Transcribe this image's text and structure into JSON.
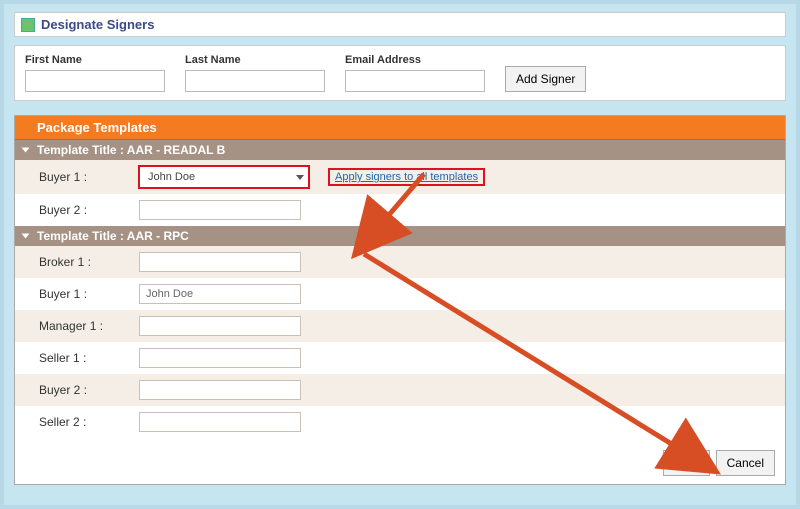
{
  "window": {
    "title": "Designate Signers"
  },
  "form": {
    "first_name": {
      "label": "First Name",
      "value": ""
    },
    "last_name": {
      "label": "Last Name",
      "value": ""
    },
    "email": {
      "label": "Email Address",
      "value": ""
    },
    "add_signer": "Add Signer"
  },
  "panel": {
    "header": "Package Templates",
    "templates": [
      {
        "title": "Template Title : AAR - READAL B",
        "rows": [
          {
            "label": "Buyer 1 :",
            "value": "John Doe",
            "dropdown": true
          },
          {
            "label": "Buyer 2 :",
            "value": ""
          }
        ],
        "apply_link": "Apply signers to all templates"
      },
      {
        "title": "Template Title : AAR - RPC",
        "rows": [
          {
            "label": "Broker 1 :",
            "value": ""
          },
          {
            "label": "Buyer 1 :",
            "value": "John Doe"
          },
          {
            "label": "Manager 1 :",
            "value": ""
          },
          {
            "label": "Seller 1 :",
            "value": ""
          },
          {
            "label": "Buyer 2 :",
            "value": ""
          },
          {
            "label": "Seller 2 :",
            "value": ""
          }
        ]
      }
    ]
  },
  "actions": {
    "next": "Next",
    "cancel": "Cancel"
  },
  "colors": {
    "accent": "#f47b20",
    "header_bg": "#a69285",
    "highlight": "#d12",
    "arrow": "#d84e24"
  }
}
